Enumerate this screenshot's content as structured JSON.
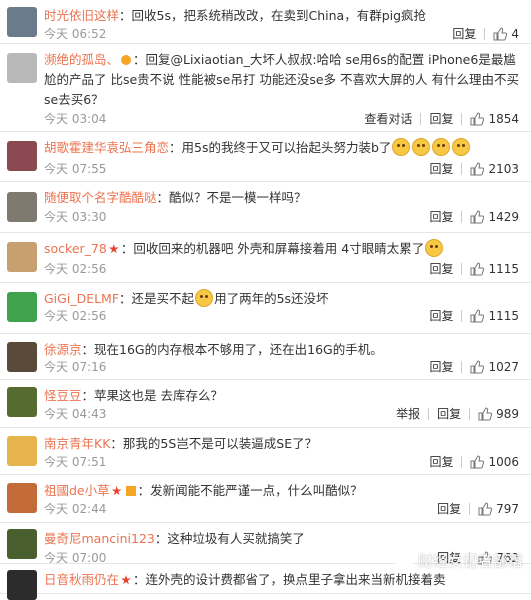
{
  "comments": [
    {
      "user": "时光依旧这样",
      "text": "回收5s，把系统稍改改，在卖到China，有群pig疯抢",
      "time": "今天 06:52",
      "likes": "4",
      "avatar_color": "#6a7b8c"
    },
    {
      "user": "濒绝的孤岛、",
      "text": "回复@Lixiaotian_大坏人叔叔:哈哈 se用6s的配置 iPhone6是最尴尬的产品了 比se贵不说 性能被se吊打 功能还没se多 不喜欢大屏的人 有什么理由不买se去买6？",
      "time": "今天 03:04",
      "likes": "1854",
      "extra_action": "查看对话",
      "avatar_color": "#b9b9b9"
    },
    {
      "user": "胡歌霍建华袁弘三角恋",
      "text": "用5s的我终于又可以抬起头努力装b了",
      "time": "今天 07:55",
      "likes": "2103",
      "avatar_color": "#8b4a52"
    },
    {
      "user": "随便取个名字酷酷哒",
      "text": "酷似？不是一模一样吗？",
      "time": "今天 03:30",
      "likes": "1429",
      "avatar_color": "#7f7a70"
    },
    {
      "user": "socker_78",
      "text": "回收回来的机器吧 外壳和屏幕接着用 4寸眼睛太累了",
      "time": "今天 02:56",
      "likes": "1115",
      "avatar_color": "#c8a070"
    },
    {
      "user": "GiGi_DELMF",
      "text": "还是买不起",
      "text2": "用了两年的5s还没坏",
      "time": "今天 02:56",
      "likes": "1115",
      "avatar_color": "#3fa34d"
    },
    {
      "user": "徐源京",
      "text": "现在16G的内存根本不够用了，还在出16G的手机。",
      "time": "今天 07:16",
      "likes": "1027",
      "avatar_color": "#5a4a3a"
    },
    {
      "user": "怪豆豆",
      "text": "苹果这也是 去库存么？",
      "time": "今天 04:43",
      "likes": "989",
      "extra_action": "举报",
      "avatar_color": "#556b2f"
    },
    {
      "user": "南京青年KK",
      "text": "那我的5S岂不是可以装逼成SE了？",
      "time": "今天 07:51",
      "likes": "1006",
      "avatar_color": "#e6b34d"
    },
    {
      "user": "祖國de小草",
      "text": "发新闻能不能严谨一点，什么叫酷似？",
      "time": "今天 02:44",
      "likes": "797",
      "avatar_color": "#c46b3a"
    },
    {
      "user": "曼奇尼mancini123",
      "text": "这种垃圾有人买就搞笑了",
      "time": "今天 07:00",
      "likes": "762",
      "avatar_color": "#4a5f2e"
    },
    {
      "user": "日音秋雨仍在",
      "text": "连外壳的设计费都省了，换点里子拿出来当新机接着卖",
      "time": "",
      "likes": "",
      "avatar_color": "#2c2c2c"
    }
  ],
  "reply_label": "回复",
  "watermark": "财经女记者部落"
}
